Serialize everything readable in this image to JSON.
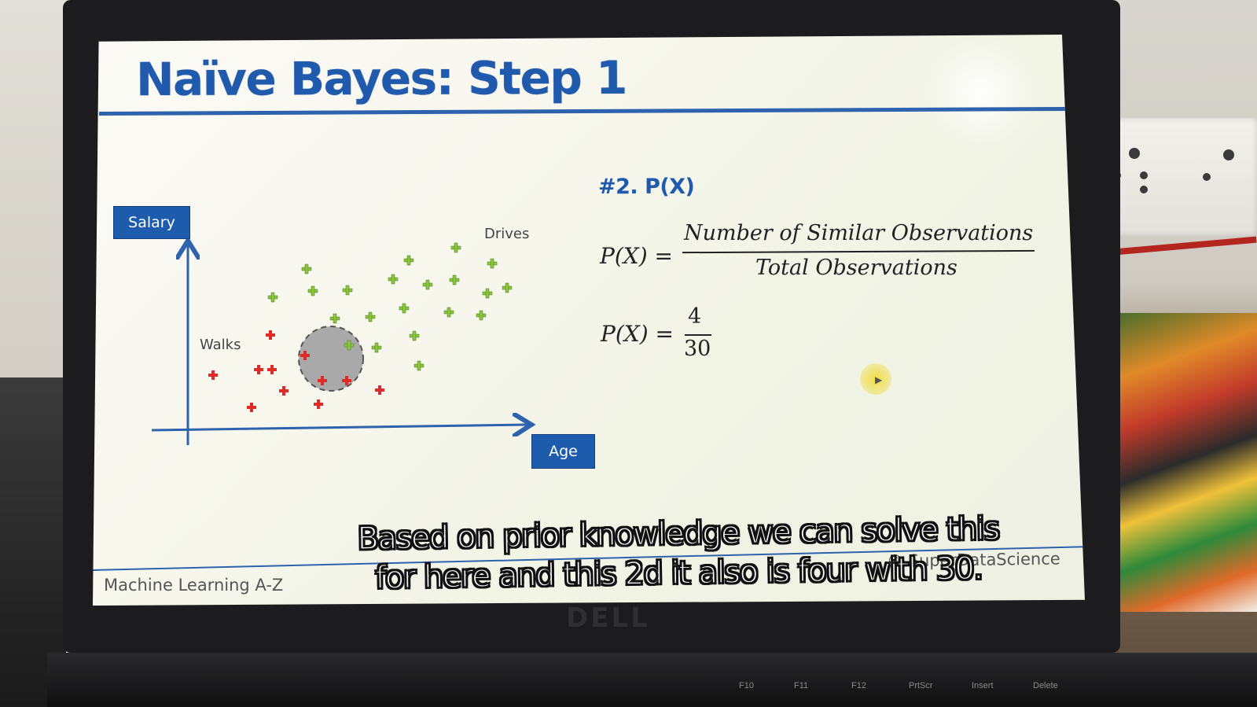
{
  "slide": {
    "title": "Naïve Bayes: Step 1",
    "footer_left": "Machine Learning A-Z",
    "footer_right": "© SuperDataScience"
  },
  "chart": {
    "y_axis_label": "Salary",
    "x_axis_label": "Age",
    "annotations": {
      "walks": "Walks",
      "drives": "Drives"
    }
  },
  "formula": {
    "heading": "#2. P(X)",
    "eq1_lhs": "P(X) =",
    "eq1_numerator": "Number of Similar Observations",
    "eq1_denominator": "Total Observations",
    "eq2_lhs": "P(X) =",
    "eq2_numerator": "4",
    "eq2_denominator": "30"
  },
  "subtitles": {
    "line1": "Based on prior knowledge we can solve this",
    "line2": "for here and this 2d it also is four with 30."
  },
  "keyboard": {
    "keys": [
      "F10",
      "F11",
      "F12",
      "PrtScr",
      "Insert",
      "Delete"
    ]
  },
  "laptop": {
    "brand": "DELL"
  },
  "colors": {
    "title_blue": "#1f5aad",
    "walks_red": "#e02a2a",
    "drives_green": "#8cc63f"
  }
}
